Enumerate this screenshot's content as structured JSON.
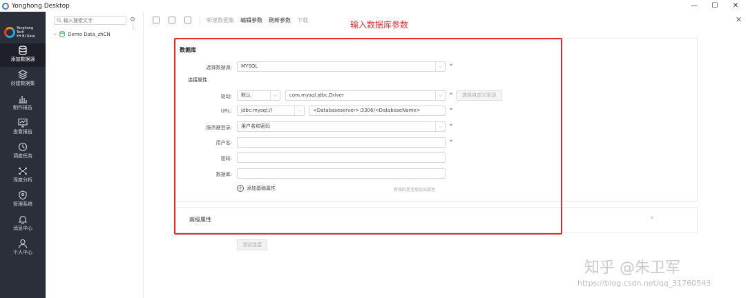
{
  "window": {
    "title": "Yonghong Desktop",
    "controls": [
      "—",
      "☐",
      "✕"
    ]
  },
  "brand": {
    "line1": "Yonghong Tech",
    "line2": "YH BI Data"
  },
  "sidebar": {
    "items": [
      {
        "label": "添加数据源",
        "icon": "database-icon"
      },
      {
        "label": "创建数据集",
        "icon": "layers-icon"
      },
      {
        "label": "制作报告",
        "icon": "chart-icon"
      },
      {
        "label": "查看报告",
        "icon": "monitor-icon"
      },
      {
        "label": "调度任务",
        "icon": "clock-icon"
      },
      {
        "label": "深度分析",
        "icon": "network-icon"
      },
      {
        "label": "管理系统",
        "icon": "shield-icon"
      },
      {
        "label": "消息中心",
        "icon": "bell-icon"
      },
      {
        "label": "个人中心",
        "icon": "user-icon"
      }
    ],
    "active_index": 0
  },
  "tree": {
    "search_placeholder": "输入搜索文字",
    "tools": "⚙ ⋮",
    "node_label": "Demo Data_zhCN"
  },
  "toolbar": {
    "new_source": "新建数据集",
    "edit_params": "编辑参数",
    "refresh_params": "刷新参数",
    "download": "下载"
  },
  "annotation": "输入数据库参数",
  "form": {
    "section_title": "数据库",
    "select_source_label": "选择数据源:",
    "select_source_value": "MYSQL",
    "conn_props_title": "连接属性",
    "driver_label": "驱动:",
    "driver_mode": "默认",
    "driver_value": "com.mysql.jdbc.Driver",
    "custom_driver_btn": "选择自定义驱动",
    "url_label": "URL:",
    "url_prefix": "jdbc:mysql://",
    "url_value": "<Databaseserver>:3306/<DatabaseName>",
    "login_label": "服务器登录:",
    "login_value": "用户名和密码",
    "user_label": "用户名:",
    "user_value": "",
    "password_label": "密码:",
    "password_value": "",
    "db_label": "数据库:",
    "db_value": "",
    "add_prop": "添加基础属性",
    "hint": "新增的是连接前的属性",
    "required_mark": "*"
  },
  "advanced": {
    "label": "高级属性"
  },
  "test_button": "测试连接",
  "watermark": {
    "brand": "知乎 @朱卫军",
    "url": "https://blog.csdn.net/qq_31760543"
  }
}
